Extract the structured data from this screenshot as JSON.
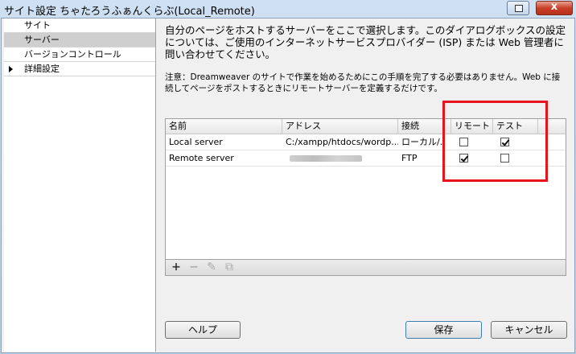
{
  "window": {
    "title": "サイト設定 ちゃたろうふぁんくらぶ(Local_Remote)",
    "close_label": "x"
  },
  "sidebar": {
    "items": [
      {
        "label": "サイト"
      },
      {
        "label": "サーバー"
      },
      {
        "label": "バージョンコントロール"
      },
      {
        "label": "詳細設定"
      }
    ]
  },
  "main": {
    "description": "自分のページをホストするサーバーをここで選択します。このダイアログボックスの設定については、ご使用のインターネットサービスプロバイダー (ISP) または Web 管理者に問い合わせてください。",
    "note": "注意：Dreamweaver のサイトで作業を始めるためにこの手順を完了する必要はありません。Web に接続してページをポストするときにリモートサーバーを定義するだけです。"
  },
  "server_table": {
    "columns": [
      "名前",
      "アドレス",
      "接続",
      "リモート",
      "テスト"
    ],
    "rows": [
      {
        "name": "Local server",
        "address": "C:/xampp/htdocs/wordp...",
        "connection": "ローカル/...",
        "remote": false,
        "test": true
      },
      {
        "name": "Remote server",
        "address": "",
        "connection": "FTP",
        "remote": true,
        "test": false
      }
    ]
  },
  "toolbar": {
    "add_symbol": "+",
    "remove_symbol": "−",
    "edit_symbol": "✎",
    "duplicate_symbol": "⧉"
  },
  "buttons": {
    "help": "ヘルプ",
    "save": "保存",
    "cancel": "キャンセル"
  },
  "colors": {
    "highlight_box": "#e8141d",
    "selected_nav": "#cfcfcf"
  }
}
